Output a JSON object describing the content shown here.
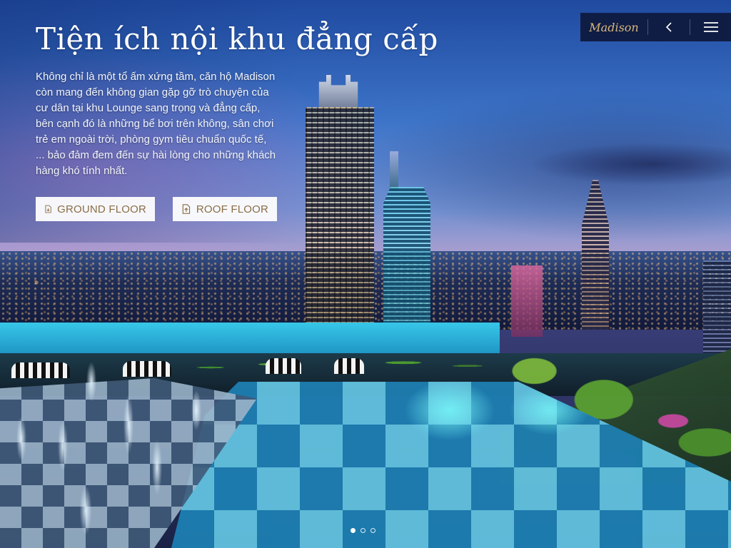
{
  "hero": {
    "title": "Tiện ích nội khu đẳng cấp",
    "description": "Không chỉ là một tổ ấm xứng tầm, căn hộ Madison còn mang đến không gian gặp gỡ trò chuyện của cư dân tại khu Lounge sang trọng và đẳng cấp, bên cạnh đó là những bể bơi trên không, sân chơi trẻ em ngoài trời, phòng gym tiêu chuẩn quốc tế, ... bảo đảm đem đến sự hài lòng cho những khách hàng khó tính nhất."
  },
  "buttons": {
    "ground_floor": {
      "label": "GROUND FLOOR",
      "icon": "floor-down-icon"
    },
    "roof_floor": {
      "label": "ROOF FLOOR",
      "icon": "floor-up-icon"
    }
  },
  "nav": {
    "brand": "Madison",
    "back_icon": "chevron-left-icon",
    "menu_icon": "hamburger-menu-icon"
  },
  "pagination": {
    "total": 3,
    "active": 1
  },
  "colors": {
    "nav_background": "#0f1d45",
    "brand_gold": "#d9b77a",
    "button_text": "#8a6d44",
    "button_background": "#ffffff"
  }
}
